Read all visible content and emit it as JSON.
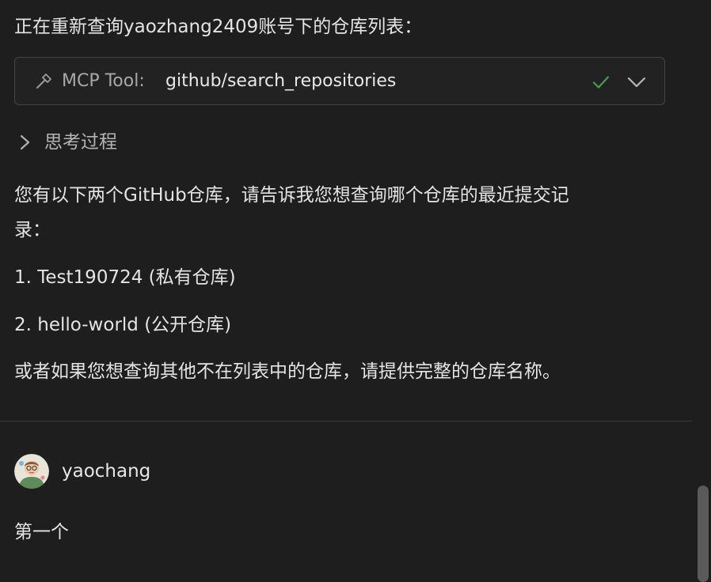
{
  "assistant": {
    "status_line": "正在重新查询yaozhang2409账号下的仓库列表：",
    "tool_call": {
      "label": "MCP Tool:",
      "name": "github/search_repositories",
      "status": "success",
      "icons": {
        "tool": "hammer-icon",
        "status": "check-icon",
        "expand": "chevron-down-icon"
      },
      "status_color": "#4e9a4e"
    },
    "thinking": {
      "label": "思考过程",
      "icon": "chevron-right-icon"
    },
    "response": {
      "intro_line1": "您有以下两个GitHub仓库，请告诉我您想查询哪个仓库的最近提交记",
      "intro_line2": "录：",
      "items": [
        "1. Test190724 (私有仓库)",
        "2. hello-world (公开仓库)"
      ],
      "outro": "或者如果您想查询其他不在列表中的仓库，请提供完整的仓库名称。"
    }
  },
  "user_message": {
    "username": "yaochang",
    "avatar": "cartoon-avatar",
    "text": "第一个"
  },
  "colors": {
    "background": "#1e1e1e",
    "text": "#e4e4e4",
    "muted": "#a8a8a8",
    "border": "#454545"
  }
}
